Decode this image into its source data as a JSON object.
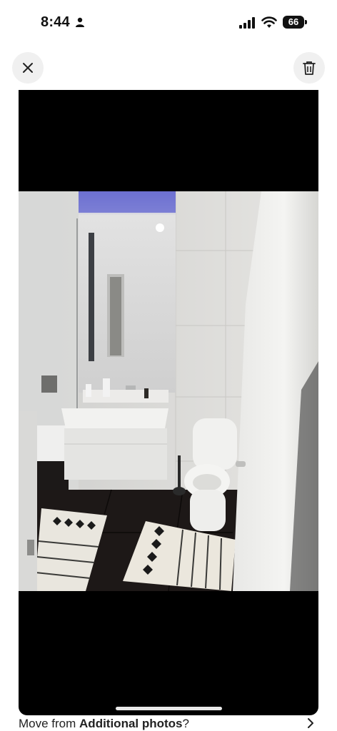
{
  "status_bar": {
    "time": "8:44",
    "battery": "66",
    "icons": [
      "person-icon",
      "signal-icon",
      "wifi-icon",
      "battery-icon"
    ]
  },
  "toolbar": {
    "close_icon": "close-icon",
    "delete_icon": "trash-icon"
  },
  "photo": {
    "subject": "bathroom"
  },
  "footer": {
    "prompt_prefix": "Move from ",
    "prompt_target": "Additional photos",
    "prompt_suffix": "?",
    "icon": "chevron-right-icon"
  },
  "colors": {
    "button_bg": "#f0f0f0",
    "photo_frame": "#000000",
    "text": "#222222"
  }
}
